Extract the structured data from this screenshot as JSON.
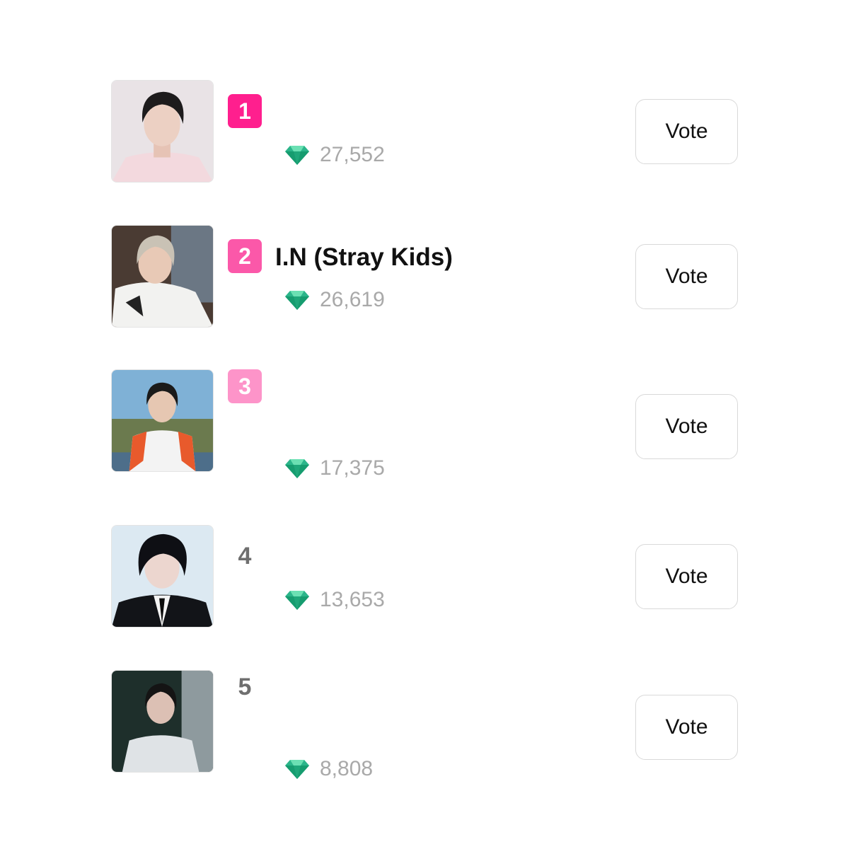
{
  "theme": {
    "badge_colors": [
      "#ff1f8e",
      "#fb58a9",
      "#fd94c9"
    ],
    "gem_color": "#2bb58a"
  },
  "ranking": [
    {
      "rank": "1",
      "name": "",
      "votes": "27,552",
      "vote_label": "Vote",
      "photo": "photo-portrait-light-shirt"
    },
    {
      "rank": "2",
      "name": "I.N (Stray Kids)",
      "votes": "26,619",
      "vote_label": "Vote",
      "photo": "photo-portrait-white-jacket"
    },
    {
      "rank": "3",
      "name": "",
      "votes": "17,375",
      "vote_label": "Vote",
      "photo": "photo-portrait-outdoor-field"
    },
    {
      "rank": "4",
      "name": "",
      "votes": "13,653",
      "vote_label": "Vote",
      "photo": "photo-portrait-dark-suit"
    },
    {
      "rank": "5",
      "name": "",
      "votes": "8,808",
      "vote_label": "Vote",
      "photo": "photo-portrait-dark-room"
    }
  ]
}
